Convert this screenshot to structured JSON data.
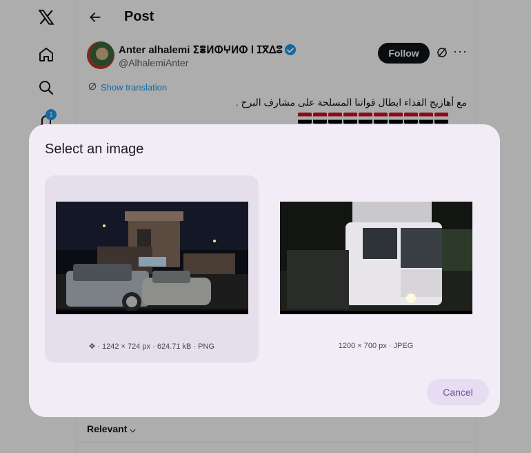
{
  "app": {
    "logo": "X",
    "header_title": "Post"
  },
  "nav": {
    "notification_count": "1"
  },
  "post": {
    "author_name": "Anter alhalemi ⵉⴻⵍⵀⵖⵍⵀ ⵏ ⵊⴳⵠⵓ",
    "handle": "@AlhalemiAnter",
    "follow_label": "Follow",
    "more_label": "···",
    "translate_label": "Show translation",
    "text": "مع أهازيج الفداء ابطال قواتنا المسلحة على مشارف البرح ."
  },
  "replies": {
    "sort_label": "Relevant"
  },
  "dialog": {
    "title": "Select an image",
    "options": [
      {
        "meta": "· 1242 × 724 px · 624.71 kB · PNG",
        "selected": true
      },
      {
        "meta": "1200 × 700 px · JPEG",
        "selected": false
      }
    ],
    "cancel_label": "Cancel"
  },
  "colors": {
    "accent": "#1d9bf0",
    "dialog_bg": "#f2ecf7",
    "selected_bg": "#e5dfec",
    "cancel_bg": "#e6ddf3",
    "cancel_text": "#65558f"
  },
  "icons": [
    "x-logo-icon",
    "home-icon",
    "search-icon",
    "notification-bell-icon",
    "back-arrow-icon",
    "verified-badge-icon",
    "grok-icon",
    "translate-icon",
    "move-icon",
    "chevron-down-icon"
  ]
}
